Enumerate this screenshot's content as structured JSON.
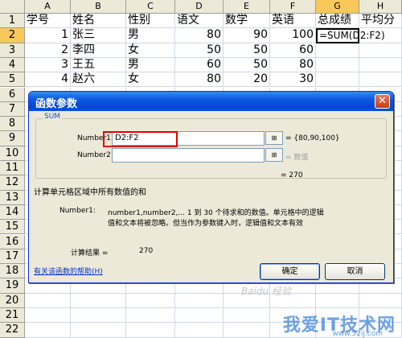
{
  "sheet": {
    "columns": [
      "A",
      "B",
      "C",
      "D",
      "E",
      "F",
      "G",
      "H"
    ],
    "selected_column": "G",
    "rows": [
      "1",
      "2",
      "3",
      "4",
      "5",
      "6",
      "7",
      "8",
      "9",
      "10",
      "11",
      "12",
      "13",
      "14",
      "15",
      "16",
      "17",
      "18",
      "19",
      "20",
      "21",
      "22"
    ],
    "selected_row": "2",
    "header_row": [
      "学号",
      "姓名",
      "性别",
      "语文",
      "数学",
      "英语",
      "总成绩",
      "平均分"
    ],
    "data_rows": [
      [
        "1",
        "张三",
        "男",
        "80",
        "90",
        "100",
        "=SUM(D2:F2)"
      ],
      [
        "2",
        "李四",
        "女",
        "50",
        "50",
        "60",
        ""
      ],
      [
        "3",
        "王五",
        "男",
        "60",
        "50",
        "80",
        ""
      ],
      [
        "4",
        "赵六",
        "女",
        "80",
        "20",
        "30",
        ""
      ]
    ]
  },
  "dialog": {
    "title": "函数参数",
    "close_glyph": "✕",
    "function_name": "SUM",
    "arg1_label": "Number1",
    "arg1_value": "D2:F2",
    "arg1_result": "= {80,90,100}",
    "arg2_label": "Number2",
    "arg2_value": "",
    "arg2_result": "= 数值",
    "formula_result": "= 270",
    "description": "计算单元格区域中所有数值的和",
    "arg_help_label": "Number1:",
    "arg_help_line1": "number1,number2,... 1 到 30 个待求和的数值。单元格中的逻辑",
    "arg_help_line2": "值和文本将被忽略。但当作为参数键入时，逻辑值和文本有效",
    "result_label": "计算结果 =",
    "result_value": "270",
    "help_link": "有关该函数的帮助(H)",
    "ok_label": "确定",
    "cancel_label": "取消",
    "ref_glyph": "⊞"
  },
  "watermark": {
    "text": "我爱IT技术网",
    "url": "www.52ij.com",
    "baidu": "Baidu 经验"
  }
}
